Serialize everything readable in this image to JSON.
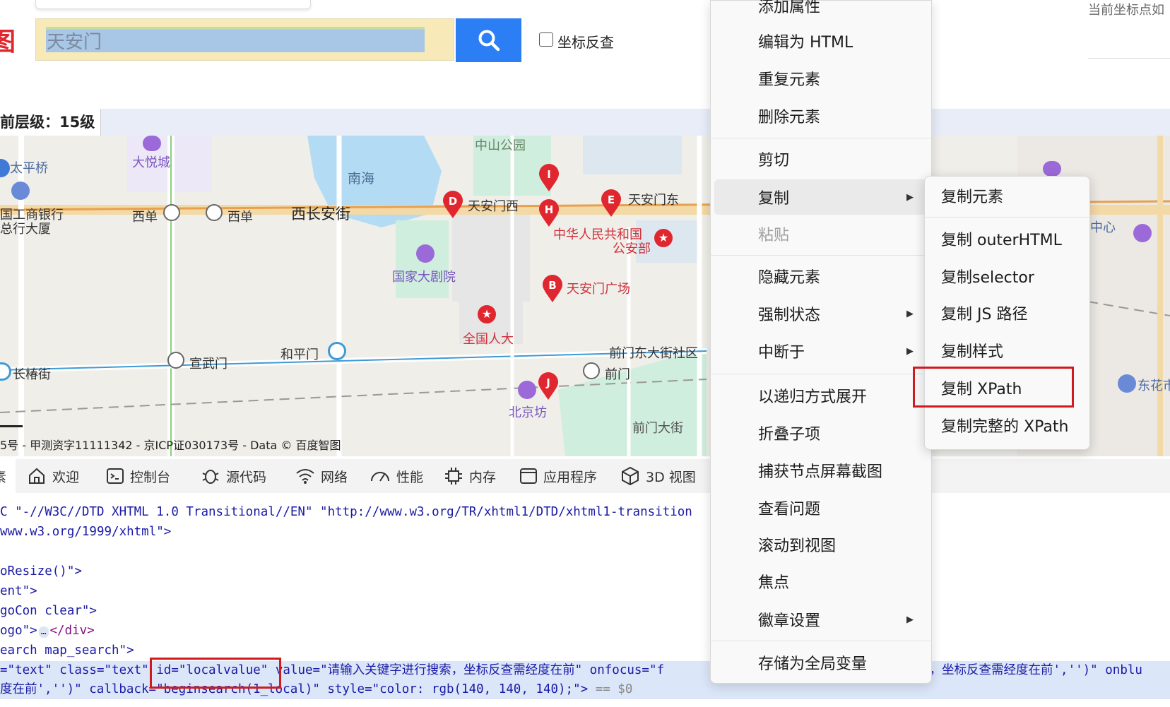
{
  "top": {
    "logo_char": "图",
    "search_value": "天安门",
    "coord_reverse_label": "坐标反查",
    "current_point_label": "当前坐标点如"
  },
  "level_bar": {
    "label": "前层级：15级"
  },
  "map": {
    "labels": {
      "taipingqiao": "太平桥",
      "dayuecheng": "大悦城",
      "zhongshan_park": "中山公园",
      "nanhai": "南海",
      "icbc_1": "国工商银行",
      "icbc_2": "总行大厦",
      "xidan_1": "西单",
      "xidan_2": "西单",
      "xichangan": "西长安街",
      "tiananmen_west": "天安门西",
      "tiananmen_east": "天安门东",
      "mps_1": "中华人民共和国",
      "mps_2": "公安部",
      "national_theater": "国家大剧院",
      "tiananmen_square": "天安门广场",
      "npc": "全国人大",
      "xuanwumen": "宣武门",
      "hepingmen": "和平门",
      "qianmen_east_community": "前门东大街社区",
      "changchun_st": "长椿街",
      "qianmen": "前门",
      "beijingfang": "北京坊",
      "qianmen_st": "前门大街",
      "center_right": "中心",
      "dongcheng_right": "东花市"
    },
    "markers": [
      "D",
      "I",
      "H",
      "E",
      "B",
      "J"
    ],
    "copyright": "5号 - 甲测资字11111342 - 京ICP证030173号 - Data © 百度智图"
  },
  "devtools": {
    "tabs": [
      "欢迎",
      "控制台",
      "源代码",
      "网络",
      "性能",
      "内存",
      "应用程序",
      "3D 视图"
    ],
    "first_tab_partial": "素",
    "code_lines": [
      "C \"-//W3C//DTD XHTML 1.0 Transitional//EN\" \"http://www.w3.org/TR/xhtml1/DTD/xhtml1-transition",
      "www.w3.org/1999/xhtml\">",
      "",
      "oResize()\">",
      "ent\">",
      "goCon clear\">",
      "ogo\">",
      "earch map_search\">"
    ],
    "logo_line_ellipsis": "…",
    "logo_line_close": "</div>",
    "sel_line_1": {
      "p1": "=\"text\" class=\"text\" ",
      "id": "id=\"localvalue\"",
      "p2": " value=\"请输入关键字进行搜索，坐标反查需经度在前\" onfocus=\"f",
      "p3": "索，坐标反查需经度在前','')\" onblu"
    },
    "sel_line_2": {
      "p1": "度在前','')\" callback=\"beginsearch(1_local)\" style=\"color: rgb(140, 140, 140);\"> ",
      "p2": "== $0"
    }
  },
  "context_menu": {
    "items": [
      {
        "label": "添加属性"
      },
      {
        "label": "编辑为 HTML"
      },
      {
        "label": "重复元素"
      },
      {
        "label": "删除元素"
      },
      {
        "label": "剪切"
      },
      {
        "label": "复制"
      },
      {
        "label": "粘贴"
      },
      {
        "label": "隐藏元素"
      },
      {
        "label": "强制状态"
      },
      {
        "label": "中断于"
      },
      {
        "label": "以递归方式展开"
      },
      {
        "label": "折叠子项"
      },
      {
        "label": "捕获节点屏幕截图"
      },
      {
        "label": "查看问题"
      },
      {
        "label": "滚动到视图"
      },
      {
        "label": "焦点"
      },
      {
        "label": "徽章设置"
      },
      {
        "label": "存储为全局变量"
      }
    ],
    "submenu": [
      {
        "label": "复制元素"
      },
      {
        "label": "复制 outerHTML"
      },
      {
        "label": "复制selector"
      },
      {
        "label": "复制 JS 路径"
      },
      {
        "label": "复制样式"
      },
      {
        "label": "复制 XPath"
      },
      {
        "label": "复制完整的 XPath"
      }
    ]
  },
  "colors": {
    "accent": "#2c7ef5",
    "highlight_red": "#d01a20",
    "marker_red": "#e0262e"
  }
}
